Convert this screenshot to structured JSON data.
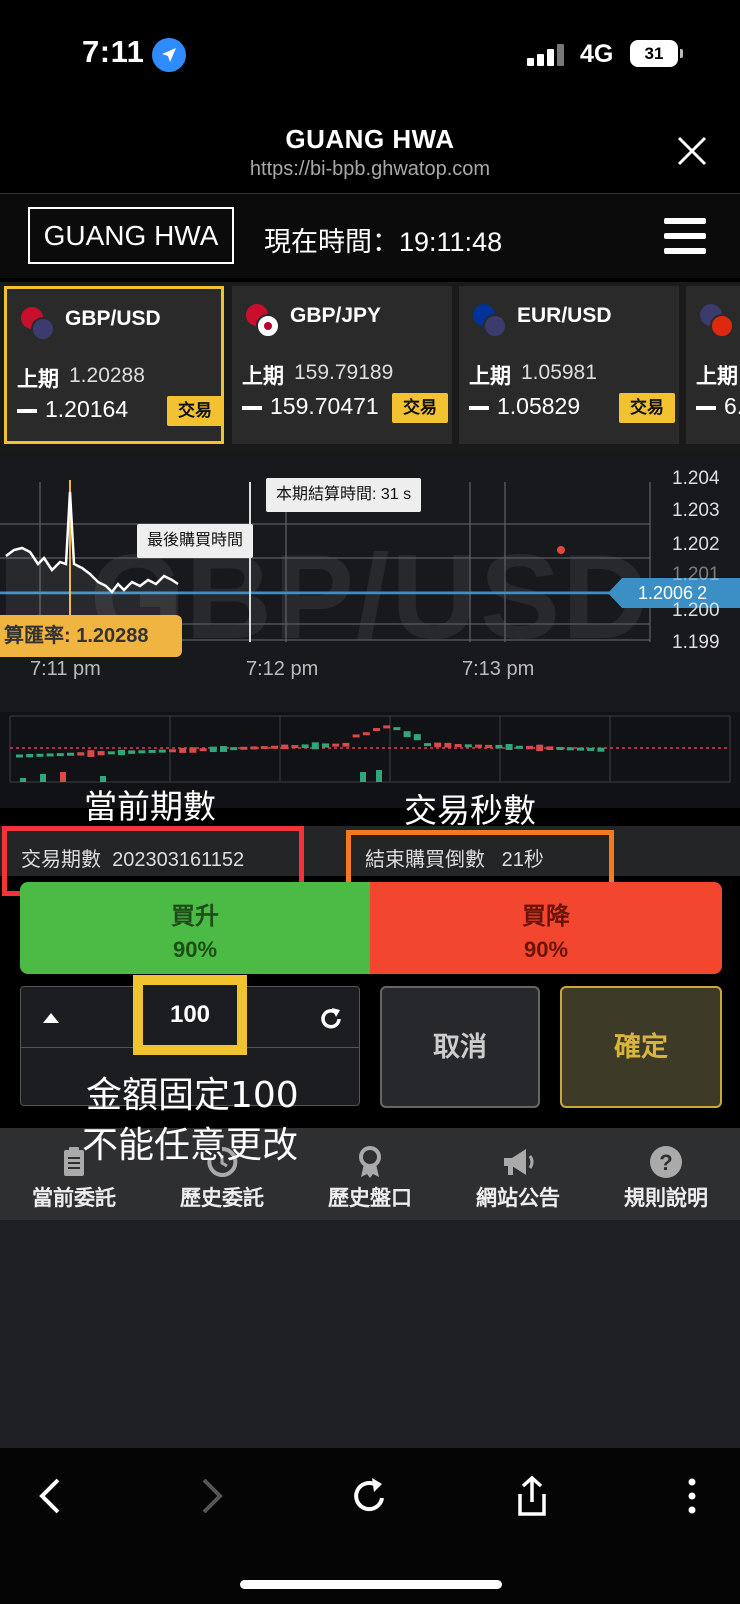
{
  "status": {
    "time": "7:11",
    "network": "4G",
    "battery": "31"
  },
  "browser": {
    "title": "GUANG HWA",
    "url": "https://bi-bpb.ghwatop.com"
  },
  "header": {
    "brand": "GUANG HWA",
    "clock_label": "現在時間：19:11:48"
  },
  "pairs": [
    {
      "name": "GBP/USD",
      "prev_label": "上期",
      "prev": "1.20288",
      "current": "1.20164",
      "trade": "交易",
      "flags": [
        "#c8102e",
        "#3c3b6e"
      ]
    },
    {
      "name": "GBP/JPY",
      "prev_label": "上期",
      "prev": "159.79189",
      "current": "159.70471",
      "trade": "交易",
      "flags": [
        "#c8102e",
        "#ffffff"
      ]
    },
    {
      "name": "EUR/USD",
      "prev_label": "上期",
      "prev": "1.05981",
      "current": "1.05829",
      "trade": "交易",
      "flags": [
        "#003399",
        "#3c3b6e"
      ]
    },
    {
      "name": "",
      "prev_label": "上期",
      "prev": "",
      "current": "6.",
      "trade": "",
      "flags": [
        "#3c3b6e",
        "#de2910"
      ]
    }
  ],
  "chart": {
    "watermark": "GBP/USD",
    "settle_tip": "本期結算時間: 31 s",
    "last_buy_tip": "最後購買時間",
    "rate_tag": "算匯率: 1.20288",
    "price_tag": "1.2006",
    "price_tag_suffix": "2",
    "y_ticks": [
      "1.204",
      "1.203",
      "1.202",
      "1.201",
      "1.200",
      "1.199"
    ],
    "x_ticks": [
      "7:11 pm",
      "7:12 pm",
      "7:13 pm"
    ]
  },
  "annotations": {
    "period": "當前期數",
    "seconds": "交易秒數",
    "amount_note_1": "金額固定100",
    "amount_note_2": "不能任意更改"
  },
  "info": {
    "period_label": "交易期數",
    "period_value": "202303161152",
    "countdown_label": "結束購買倒數",
    "countdown_value": "21秒"
  },
  "buy": {
    "label": "買升",
    "pct": "90%"
  },
  "sell": {
    "label": "買降",
    "pct": "90%"
  },
  "amount": "100",
  "actions": {
    "cancel": "取消",
    "confirm": "確定"
  },
  "tabs": [
    {
      "label": "當前委託",
      "icon": "clipboard-icon"
    },
    {
      "label": "歷史委託",
      "icon": "history-icon"
    },
    {
      "label": "歷史盤口",
      "icon": "award-icon"
    },
    {
      "label": "網站公告",
      "icon": "megaphone-icon"
    },
    {
      "label": "規則說明",
      "icon": "help-icon"
    }
  ]
}
